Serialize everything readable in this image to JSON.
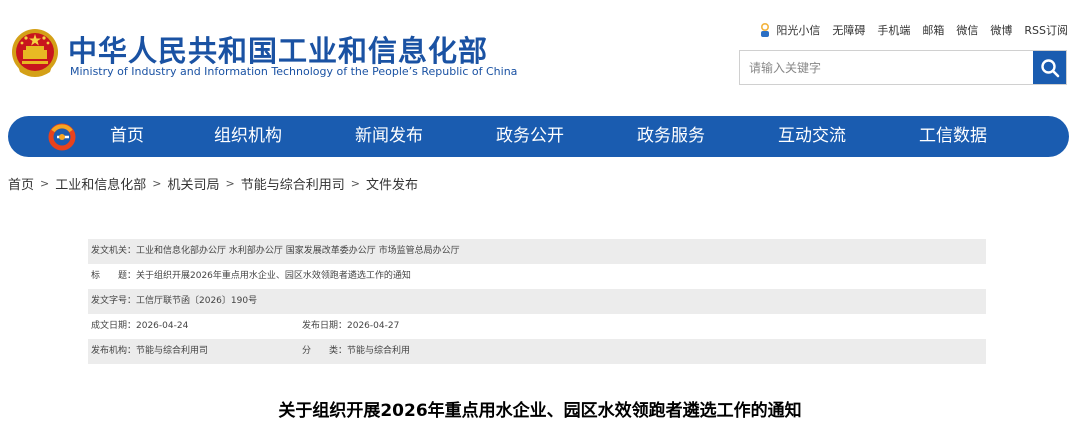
{
  "header": {
    "title": "中华人民共和国工业和信息化部",
    "subtitle": "Ministry of Industry and Information Technology of the People’s Republic of China",
    "emblem_icon": "national-emblem-icon",
    "brand_color": "#1a52a3"
  },
  "top_links": {
    "sunshine": "阳光小信",
    "accessibility": "无障碍",
    "mobile": "手机端",
    "mail": "邮箱",
    "wechat": "微信",
    "weibo": "微博",
    "rss": "RSS订阅"
  },
  "search": {
    "placeholder": "请输入关键字",
    "button_icon": "search-icon"
  },
  "nav": {
    "bar_color": "#1a5cb0",
    "logo_icon": "miit-logo-icon",
    "items": [
      "首页",
      "组织机构",
      "新闻发布",
      "政务公开",
      "政务服务",
      "互动交流",
      "工信数据"
    ]
  },
  "breadcrumb": [
    "首页",
    "工业和信息化部",
    "机关司局",
    "节能与综合利用司",
    "文件发布"
  ],
  "info": {
    "issuer": "发文机关：工业和信息化部办公厅 水利部办公厅 国家发展改革委办公厅 市场监管总局办公厅",
    "title": "标　　题：关于组织开展2026年重点用水企业、园区水效领跑者遴选工作的通知",
    "doc_number": "发文字号：工信厅联节函〔2026〕190号",
    "written_date": "成文日期：2026-04-24",
    "publish_date": "发布日期：2026-04-27",
    "publisher": "发布机构：节能与综合利用司",
    "category": "分　　类：节能与综合利用"
  },
  "article": {
    "title": "关于组织开展2026年重点用水企业、园区水效领跑者遴选工作的通知"
  }
}
